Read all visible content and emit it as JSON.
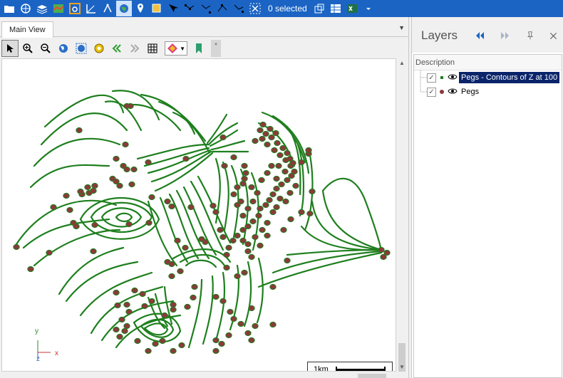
{
  "toolbar": {
    "selection_count": "0 selected",
    "icons": [
      "folder-icon",
      "globe-tools-icon",
      "layers-stack-icon",
      "map-icon",
      "layer-b-icon",
      "angle-measure-icon",
      "network-icon",
      "globe-icon",
      "pin-icon",
      "select-rect-icon",
      "pointer-node-icon",
      "node-edit-icon",
      "node-add-icon",
      "node-move-icon",
      "node-delete-icon",
      "clear-selection-icon",
      "copy-selection-icon",
      "table-view-icon",
      "excel-export-icon",
      "dropdown-icon"
    ]
  },
  "document": {
    "tab_label": "Main View",
    "view_tools": [
      "arrow-pointer-icon",
      "zoom-in-icon",
      "zoom-out-icon",
      "globe-full-icon",
      "globe-zoom-icon",
      "settings-gear-icon",
      "previous-view-icon",
      "next-view-icon",
      "grid-icon",
      "color-map-icon",
      "bookmark-icon"
    ],
    "star_label": "*"
  },
  "map": {
    "axis_y_label": "y",
    "axis_x_label": "x",
    "axis_z_label": "z",
    "scale_label": "1km",
    "contour_color": "#1e7f1e",
    "peg_color": "#8b3a3a"
  },
  "layers": {
    "title": "Layers",
    "column_header": "Description",
    "items": [
      {
        "label": "Pegs - Contours of Z at 100",
        "checked": "✓",
        "selected": true
      },
      {
        "label": "Pegs",
        "checked": "✓",
        "selected": false
      }
    ]
  }
}
